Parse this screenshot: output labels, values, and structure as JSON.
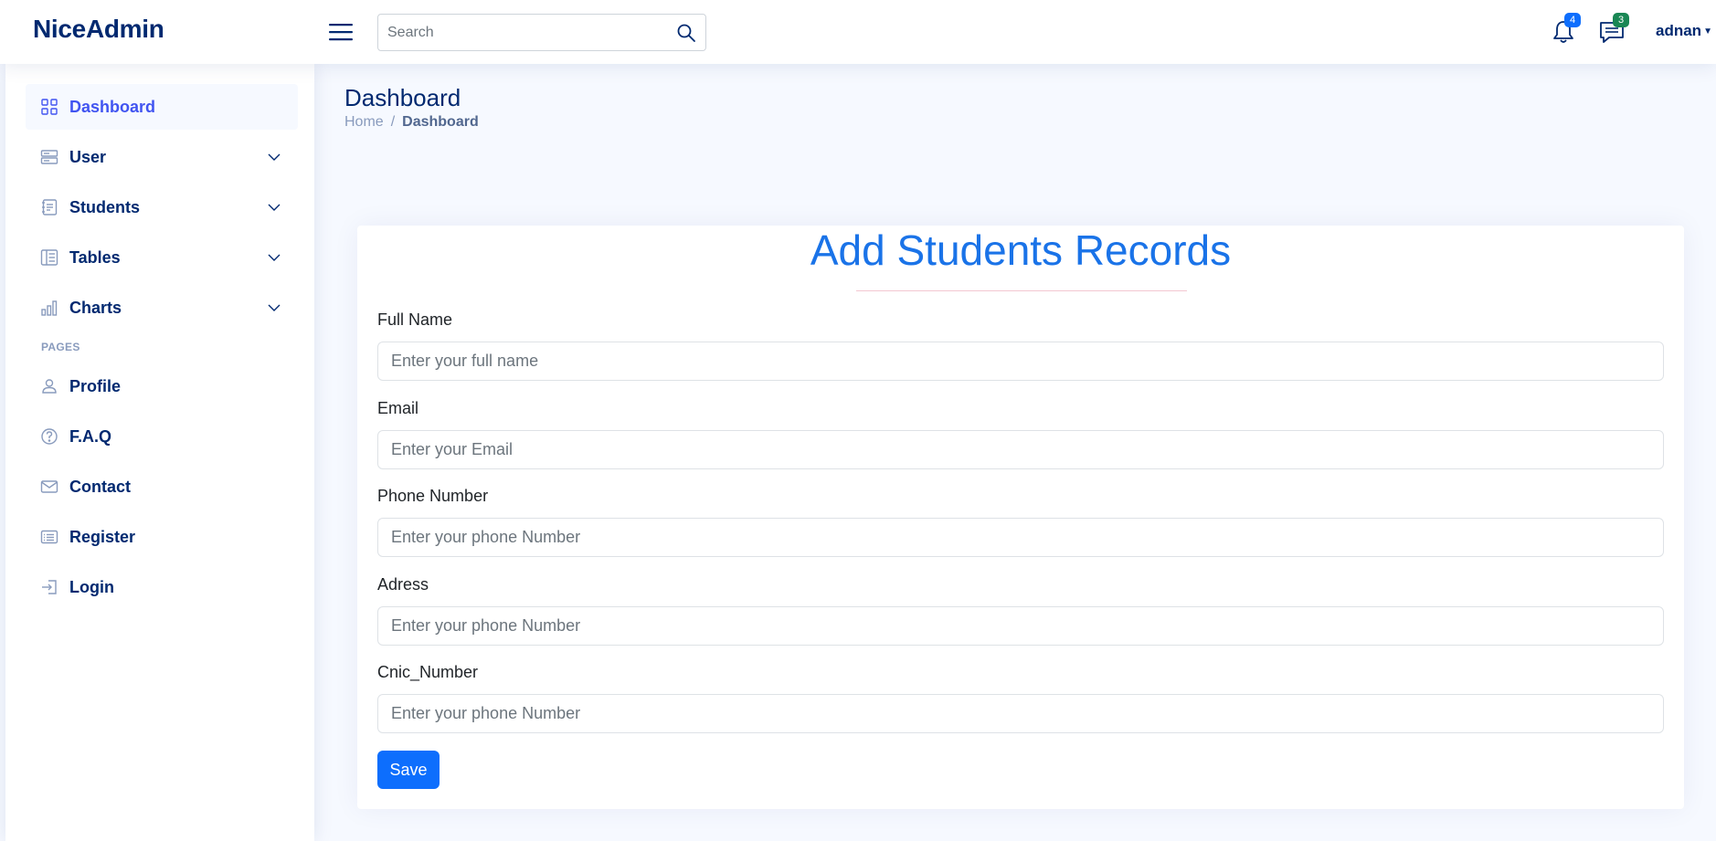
{
  "header": {
    "logo": "NiceAdmin",
    "search_placeholder": "Search",
    "notifications_count": "4",
    "messages_count": "3",
    "user_name": "adnan"
  },
  "sidebar": {
    "items": [
      {
        "label": "Dashboard",
        "icon": "grid-icon"
      },
      {
        "label": "User",
        "icon": "menu-button-icon"
      },
      {
        "label": "Students",
        "icon": "journal-text-icon"
      },
      {
        "label": "Tables",
        "icon": "layout-text-sidebar-icon"
      },
      {
        "label": "Charts",
        "icon": "bar-chart-icon"
      }
    ],
    "pages_heading": "PAGES",
    "pages": [
      {
        "label": "Profile",
        "icon": "person-icon"
      },
      {
        "label": "F.A.Q",
        "icon": "question-circle-icon"
      },
      {
        "label": "Contact",
        "icon": "envelope-icon"
      },
      {
        "label": "Register",
        "icon": "card-list-icon"
      },
      {
        "label": "Login",
        "icon": "box-arrow-in-right-icon"
      }
    ]
  },
  "main": {
    "title": "Dashboard",
    "breadcrumb": {
      "home": "Home",
      "separator": "/",
      "current": "Dashboard"
    }
  },
  "form": {
    "title": "Add Students Records",
    "fields": [
      {
        "label": "Full Name",
        "placeholder": "Enter your full name"
      },
      {
        "label": "Email",
        "placeholder": "Enter your Email"
      },
      {
        "label": "Phone Number",
        "placeholder": "Enter your phone Number"
      },
      {
        "label": "Adress",
        "placeholder": "Enter your phone Number"
      },
      {
        "label": "Cnic_Number",
        "placeholder": "Enter your phone Number"
      }
    ],
    "save_label": "Save"
  },
  "colors": {
    "primary": "#012970",
    "accent": "#4154f1",
    "title_blue": "#1a73e8",
    "button": "#0d6efd",
    "badge_primary": "#0d6efd",
    "badge_success": "#198754"
  }
}
